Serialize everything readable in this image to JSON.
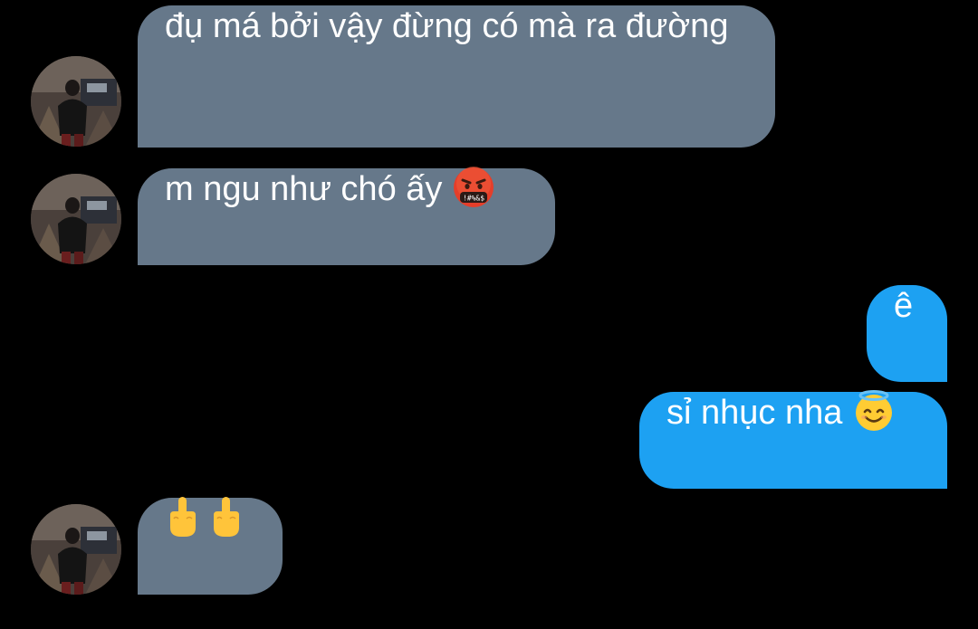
{
  "messages": [
    {
      "direction": "incoming",
      "text": "đụ má bởi vậy đừng có mà ra đường",
      "emoji": ""
    },
    {
      "direction": "incoming",
      "text": "m ngu như chó ấy ",
      "emoji": "face-with-symbols-on-mouth-icon"
    },
    {
      "direction": "outgoing",
      "text": "ê",
      "emoji": ""
    },
    {
      "direction": "outgoing",
      "text": "sỉ nhục nha ",
      "emoji": "smiling-face-with-halo-icon"
    },
    {
      "direction": "incoming",
      "text": "",
      "emoji": "middle-finger-icon middle-finger-icon"
    }
  ],
  "emoji_glyphs": {
    "symbols_on_mouth": "!#%&$"
  },
  "colors": {
    "background": "#000000",
    "incoming_bubble": "#66788a",
    "outgoing_bubble": "#1da1f2",
    "text": "#ffffff"
  }
}
